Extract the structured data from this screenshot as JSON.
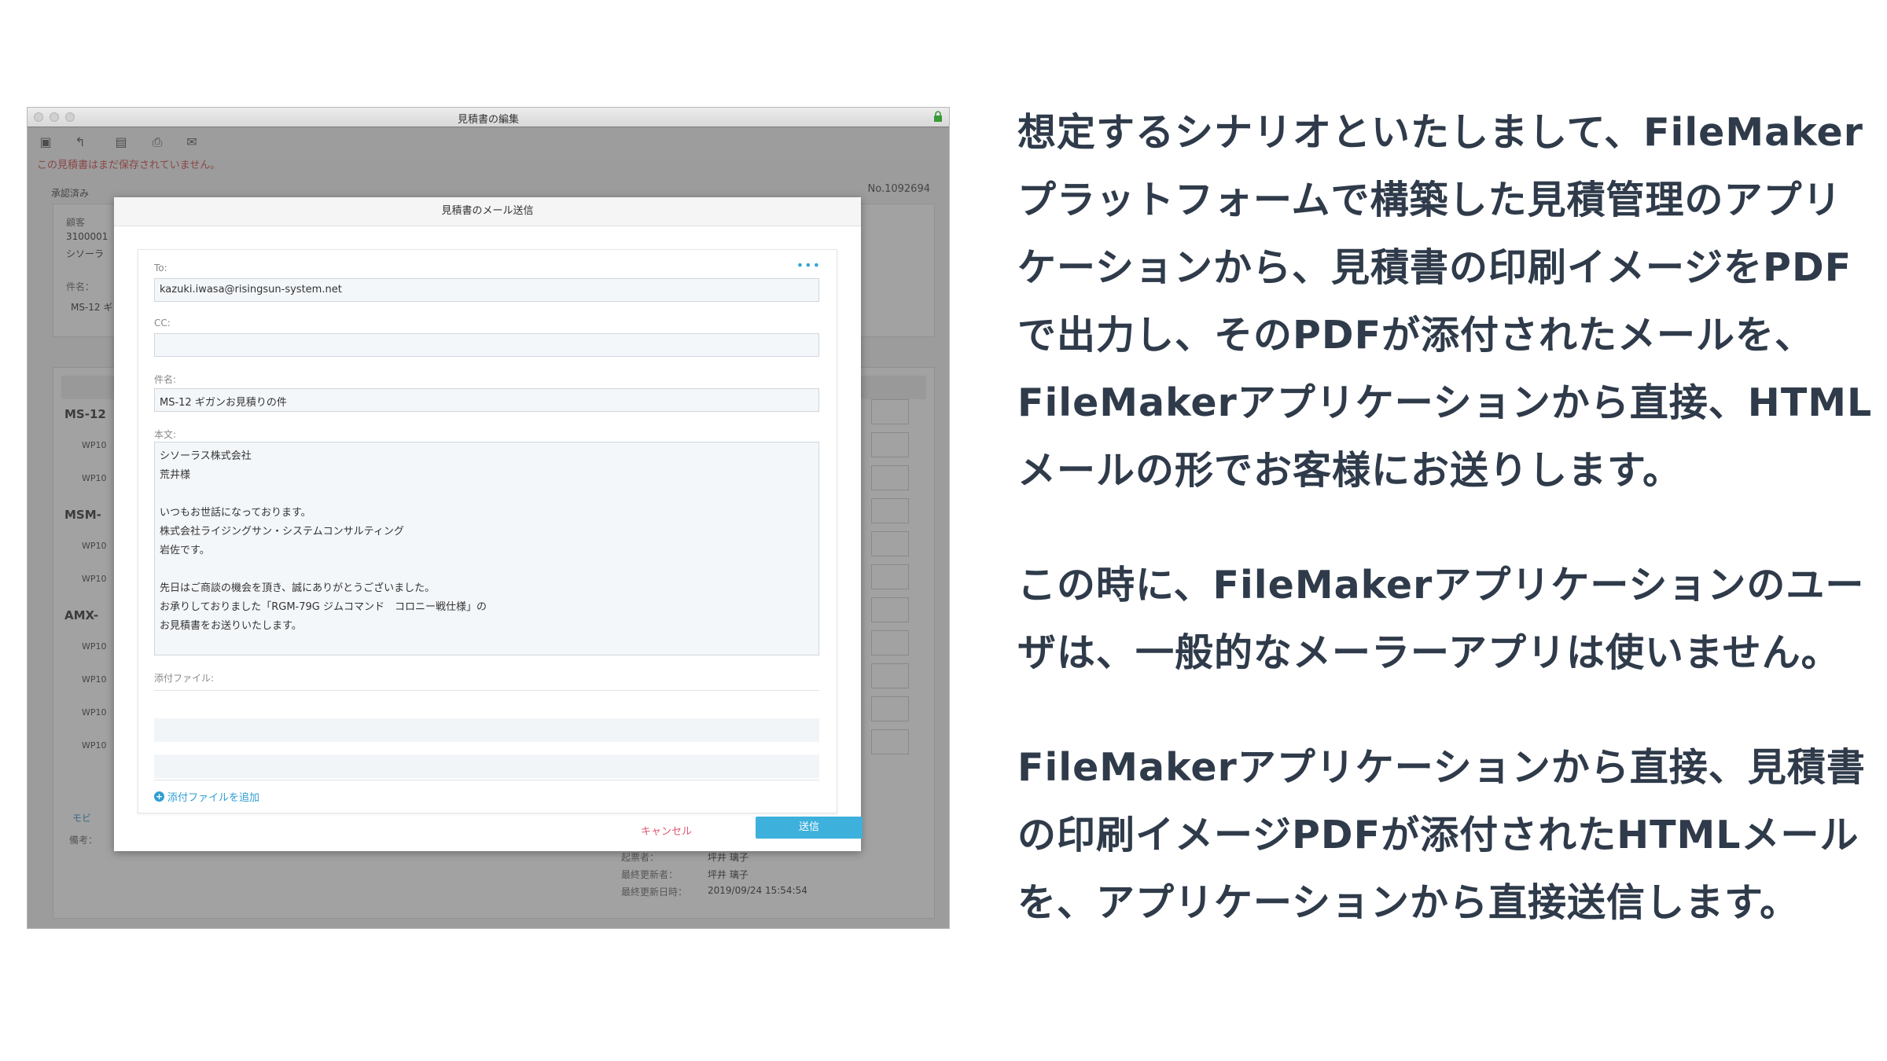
{
  "window": {
    "title": "見積書の編集",
    "warning": "この見積書はまだ保存されていません。",
    "status": "承認済み",
    "doc_no": "No.1092694"
  },
  "background_form": {
    "customer_label": "顧客",
    "customer_code": "3100001",
    "customer_name": "シソーラ",
    "subject_label": "件名：",
    "subject_value": "MS-12 ギ",
    "groups": [
      "MS-12",
      "MSM-",
      "AMX-"
    ],
    "rows": [
      "WP10",
      "WP10",
      "WP10",
      "WP10",
      "WP10",
      "WP10",
      "WP10",
      "WP10"
    ],
    "add_label": "モビ",
    "note_label": "備考：",
    "meta": {
      "creator_label": "起票者：",
      "creator": "坪井 璃子",
      "updater_label": "最終更新者：",
      "updater": "坪井 璃子",
      "updated_label": "最終更新日時：",
      "updated": "2019/09/24 15:54:54"
    }
  },
  "modal": {
    "title": "見積書のメール送信",
    "to_label": "To:",
    "to_value": "kazuki.iwasa@risingsun-system.net",
    "cc_label": "CC:",
    "cc_value": "",
    "subject_label": "件名:",
    "subject_value": "MS-12 ギガンお見積りの件",
    "body_label": "本文:",
    "body_lines": [
      "シソーラス株式会社",
      "荒井様",
      "",
      "いつもお世話になっております。",
      "株式会社ライジングサン・システムコンサルティング",
      "岩佐です。",
      "",
      "先日はご商談の機会を頂き、誠にありがとうございました。",
      "お承りしておりました「RGM-79G ジムコマンド　コロニー戦仕様」の",
      "お見積書をお送りいたします。"
    ],
    "attachments_label": "添付ファイル:",
    "add_attachment": "添付ファイルを追加",
    "cancel_label": "キャンセル",
    "send_label": "送信",
    "more_icon": "ellipsis-icon"
  },
  "description": {
    "p1": [
      "想定するシナリオといたしまして、FileMaker",
      "プラットフォームで構築した見積管理のアプリ",
      "ケーションから、見積書の印刷イメージをPDF",
      "で出力し、そのPDFが添付されたメールを、",
      "FileMakerアプリケーションから直接、HTML",
      "メールの形でお客様にお送りします。"
    ],
    "p2": [
      "この時に、FileMakerアプリケーションのユー",
      "ザは、一般的なメーラーアプリは使いません。"
    ],
    "p3": [
      "FileMakerアプリケーションから直接、見積書",
      "の印刷イメージPDFが添付されたHTMLメール",
      "を、アプリケーションから直接送信します。"
    ]
  }
}
